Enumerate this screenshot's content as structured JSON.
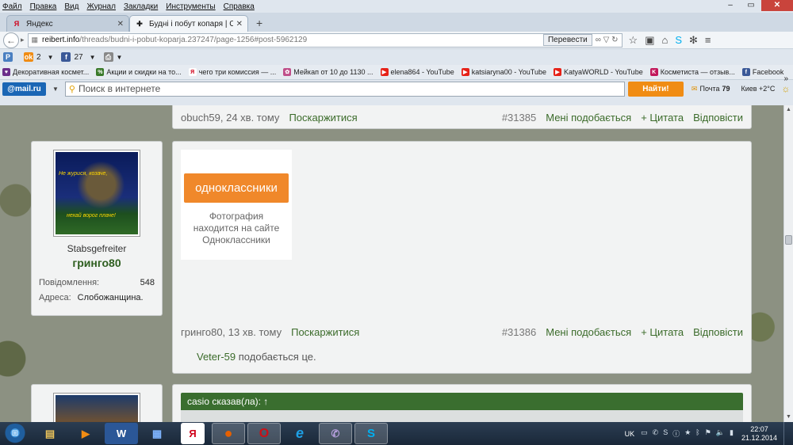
{
  "browser": {
    "menu": [
      "Файл",
      "Правка",
      "Вид",
      "Журнал",
      "Закладки",
      "Инструменты",
      "Справка"
    ],
    "tabs": [
      {
        "title": "Яндекс",
        "icon": "yandex-icon",
        "active": false
      },
      {
        "title": "Будні і побут копаря | Сто...",
        "icon": "site-icon",
        "active": true
      }
    ],
    "url_host": "reibert.info",
    "url_path": "/threads/budni-i-pobut-koparja.237247/page-1256#post-5962129",
    "translate_label": "Перевести",
    "bookmarks_top": [
      {
        "label": "",
        "icon": "p-icon",
        "color": "#4a7fc1"
      },
      {
        "label": "2",
        "icon": "odnoklassniki-icon",
        "color": "#f08c14"
      },
      {
        "label": "27",
        "icon": "facebook-icon",
        "color": "#3b5998"
      },
      {
        "label": "",
        "icon": "print-icon",
        "color": "#888888"
      }
    ],
    "bookmarks": [
      {
        "label": "Декоративная космет...",
        "icon": "cosmetics-icon",
        "color": "#6b2e8a"
      },
      {
        "label": "Акции и скидки на то...",
        "icon": "sale-icon",
        "color": "#3a7a2a"
      },
      {
        "label": "чего три комиссия — ...",
        "icon": "yandex-icon",
        "color": "#d0021b"
      },
      {
        "label": "Мейкап от 10 до 1130 ...",
        "icon": "flower-icon",
        "color": "#c0508a"
      },
      {
        "label": "elena864 - YouTube",
        "icon": "youtube-icon",
        "color": "#e62117"
      },
      {
        "label": "katsiaryna00 - YouTube",
        "icon": "youtube-icon",
        "color": "#e62117"
      },
      {
        "label": "KatyaWORLD - YouTube",
        "icon": "youtube-icon",
        "color": "#e62117"
      },
      {
        "label": "Косметиста — отзыв...",
        "icon": "cosmetista-icon",
        "color": "#c2185b"
      },
      {
        "label": "Facebook",
        "icon": "facebook-icon",
        "color": "#3b5998"
      }
    ],
    "bookmarks_more": "»",
    "mailru": {
      "logo": "@mail.ru",
      "search_placeholder": "Поиск в интернете",
      "find_label": "Найти!",
      "mail_label": "Почта",
      "mail_count": "79",
      "weather": "Киев +2°C"
    }
  },
  "page": {
    "prev_post_footer": {
      "author": "obuch59, 24 хв. тому",
      "report": "Поскаржитися",
      "number": "#31385",
      "like": "Мені подобається",
      "quote": "+ Цитата",
      "reply": "Відповісти"
    },
    "post": {
      "avatar_text_top": "Не журися, козаче,",
      "avatar_text_bottom": "нехай ворог плаче!",
      "user_title": "Stabsgefreiter",
      "username": "гринго80",
      "messages_label": "Повідомлення:",
      "messages_value": "548",
      "address_label": "Адреса:",
      "address_value": "Слобожанщина.",
      "image_logo": "одноклассники",
      "image_caption_1": "Фотография",
      "image_caption_2": "находится на сайте",
      "image_caption_3": "Одноклассники",
      "footer": {
        "author": "гринго80, 13 хв. тому",
        "report": "Поскаржитися",
        "number": "#31386",
        "like": "Мені подобається",
        "quote": "+ Цитата",
        "reply": "Відповісти"
      },
      "likes_user": "Veter-59",
      "likes_suffix": " подобається це."
    },
    "next_post": {
      "quote_header": "casio сказав(ла): ↑"
    }
  },
  "taskbar": {
    "apps": [
      {
        "name": "explorer-icon",
        "glyph": "▤",
        "color": "#e8c15a"
      },
      {
        "name": "media-player-icon",
        "glyph": "▶",
        "color": "#f08c14"
      },
      {
        "name": "word-icon",
        "glyph": "W",
        "color": "#2b5797"
      },
      {
        "name": "calculator-icon",
        "glyph": "▦",
        "color": "#3a7bd5"
      },
      {
        "name": "yandex-browser-icon",
        "glyph": "Я",
        "color": "#d0021b"
      },
      {
        "name": "firefox-icon",
        "glyph": "●",
        "color": "#e66000"
      },
      {
        "name": "opera-icon",
        "glyph": "O",
        "color": "#cc0f16"
      },
      {
        "name": "ie-icon",
        "glyph": "e",
        "color": "#1ea0e6"
      },
      {
        "name": "viber-icon",
        "glyph": "✆",
        "color": "#7b519d"
      },
      {
        "name": "skype-icon",
        "glyph": "S",
        "color": "#00aff0"
      }
    ],
    "lang": "UK",
    "time": "22:07",
    "date": "21.12.2014"
  }
}
